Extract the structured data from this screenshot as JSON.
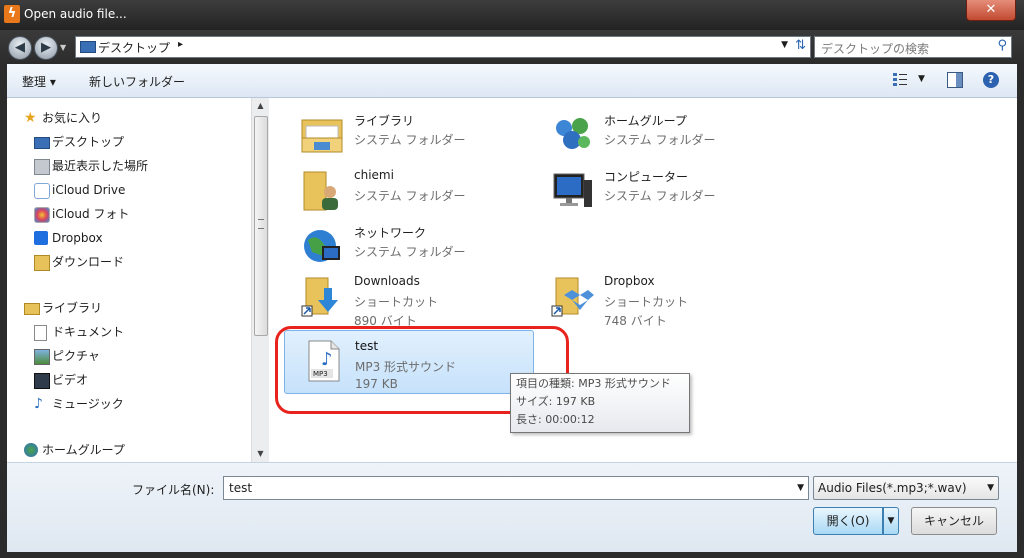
{
  "window": {
    "title": "Open audio file...",
    "close_label": "✕"
  },
  "address": {
    "path": "デスクトップ",
    "chevron": "▸"
  },
  "search": {
    "placeholder": "デスクトップの検索"
  },
  "toolbar": {
    "organize_label": "整理 ▾",
    "newfolder_label": "新しいフォルダー"
  },
  "sidebar": {
    "favorites_header": "お気に入り",
    "favorites": [
      {
        "label": "デスクトップ",
        "icon": "desktop-icon"
      },
      {
        "label": "最近表示した場所",
        "icon": "recent-places-icon"
      },
      {
        "label": "iCloud Drive",
        "icon": "icloud-icon"
      },
      {
        "label": "iCloud フォト",
        "icon": "icloud-photos-icon"
      },
      {
        "label": "Dropbox",
        "icon": "dropbox-icon"
      },
      {
        "label": "ダウンロード",
        "icon": "downloads-icon"
      }
    ],
    "libraries_header": "ライブラリ",
    "libraries": [
      {
        "label": "ドキュメント",
        "icon": "documents-icon"
      },
      {
        "label": "ピクチャ",
        "icon": "pictures-icon"
      },
      {
        "label": "ビデオ",
        "icon": "videos-icon"
      },
      {
        "label": "ミュージック",
        "icon": "music-icon"
      }
    ],
    "homegroup_header": "ホームグループ"
  },
  "files": [
    {
      "name": "ライブラリ",
      "line2": "システム フォルダー",
      "line3": "",
      "icon": "library-folder-icon"
    },
    {
      "name": "ホームグループ",
      "line2": "システム フォルダー",
      "line3": "",
      "icon": "homegroup-icon"
    },
    {
      "name": "chiemi",
      "line2": "システム フォルダー",
      "line3": "",
      "icon": "user-folder-icon"
    },
    {
      "name": "コンピューター",
      "line2": "システム フォルダー",
      "line3": "",
      "icon": "computer-icon"
    },
    {
      "name": "ネットワーク",
      "line2": "システム フォルダー",
      "line3": "",
      "icon": "network-icon"
    },
    {
      "name": "Downloads",
      "line2": "ショートカット",
      "line3": "890 バイト",
      "icon": "downloads-shortcut-icon"
    },
    {
      "name": "Dropbox",
      "line2": "ショートカット",
      "line3": "748 バイト",
      "icon": "dropbox-shortcut-icon"
    },
    {
      "name": "test",
      "line2": "MP3 形式サウンド",
      "line3": "197 KB",
      "icon": "mp3-file-icon"
    }
  ],
  "tooltip": {
    "line1": "項目の種類: MP3 形式サウンド",
    "line2": "サイズ: 197 KB",
    "line3": "長さ: 00:00:12"
  },
  "bottom": {
    "filename_label": "ファイル名(N):",
    "filename_value": "test",
    "filetype_value": "Audio Files(*.mp3;*.wav)",
    "open_label": "開く(O)",
    "cancel_label": "キャンセル"
  },
  "colors": {
    "highlight": "#e8221c",
    "selection": "#c6e2fb"
  }
}
